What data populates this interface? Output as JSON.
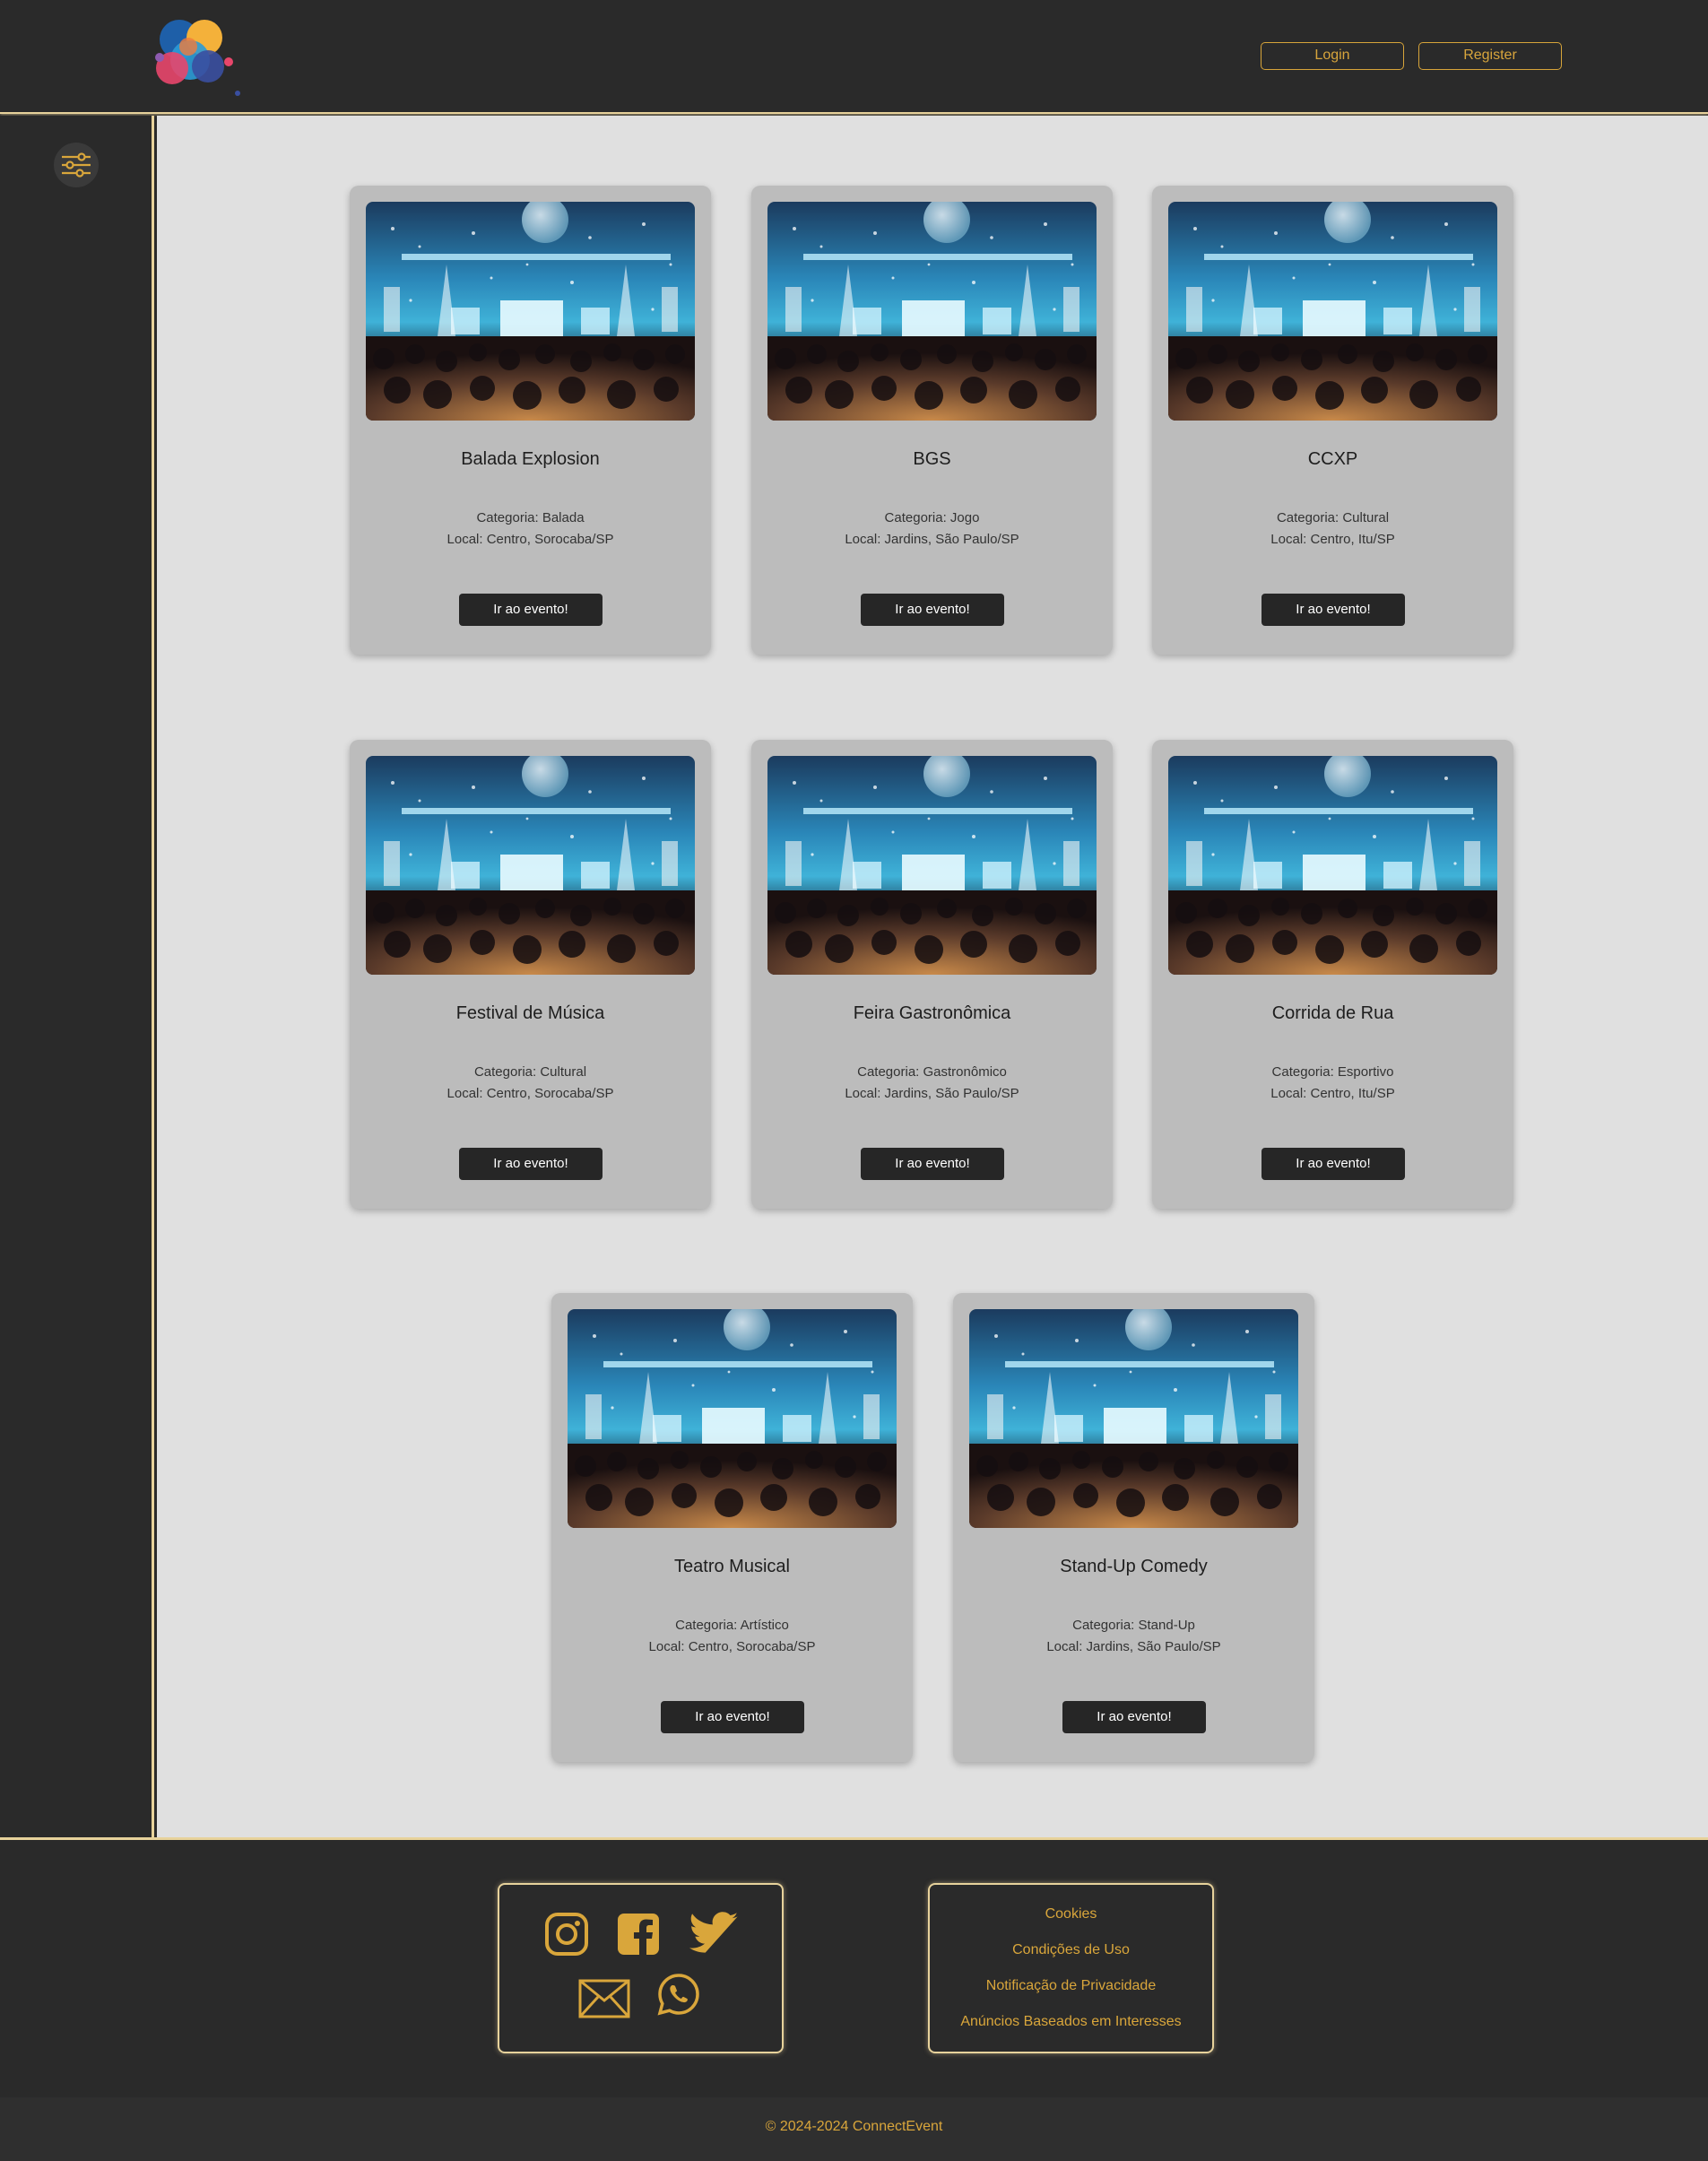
{
  "header": {
    "login_label": "Login",
    "register_label": "Register"
  },
  "colors": {
    "accent": "#d9a63b",
    "border_glow": "#e7d29b",
    "dark_bg": "#2a2a2a",
    "main_bg": "#e0e0e0",
    "card_bg": "#bcbcbc"
  },
  "sidebar": {
    "filter_icon": "sliders-icon"
  },
  "events": [
    {
      "title": "Balada Explosion",
      "category": "Categoria: Balada",
      "location": "Local: Centro, Sorocaba/SP",
      "button": "Ir ao evento!"
    },
    {
      "title": "BGS",
      "category": "Categoria: Jogo",
      "location": "Local: Jardins, São Paulo/SP",
      "button": "Ir ao evento!"
    },
    {
      "title": "CCXP",
      "category": "Categoria: Cultural",
      "location": "Local: Centro, Itu/SP",
      "button": "Ir ao evento!"
    },
    {
      "title": "Festival de Música",
      "category": "Categoria: Cultural",
      "location": "Local: Centro, Sorocaba/SP",
      "button": "Ir ao evento!"
    },
    {
      "title": "Feira Gastronômica",
      "category": "Categoria: Gastronômico",
      "location": "Local: Jardins, São Paulo/SP",
      "button": "Ir ao evento!"
    },
    {
      "title": "Corrida de Rua",
      "category": "Categoria: Esportivo",
      "location": "Local: Centro, Itu/SP",
      "button": "Ir ao evento!"
    },
    {
      "title": "Teatro Musical",
      "category": "Categoria: Artístico",
      "location": "Local: Centro, Sorocaba/SP",
      "button": "Ir ao evento!"
    },
    {
      "title": "Stand-Up Comedy",
      "category": "Categoria: Stand-Up",
      "location": "Local: Jardins, São Paulo/SP",
      "button": "Ir ao evento!"
    }
  ],
  "footer": {
    "social_icons": [
      "instagram-icon",
      "facebook-icon",
      "twitter-icon",
      "email-icon",
      "whatsapp-icon"
    ],
    "links": [
      "Cookies",
      "Condições de Uso",
      "Notificação de Privacidade",
      "Anúncios Baseados em Interesses"
    ],
    "copyright": "© 2024-2024 ConnectEvent"
  }
}
